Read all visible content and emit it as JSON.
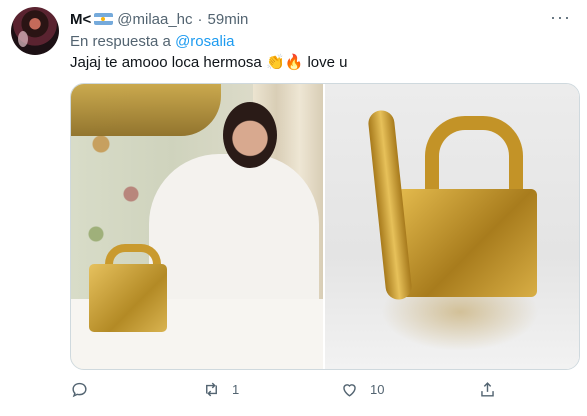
{
  "tweet": {
    "display_name": "M<",
    "handle": "@milaa_hc",
    "separator": "·",
    "time": "59min",
    "reply_prefix": "En respuesta a",
    "reply_mention": "@rosalia",
    "text_before_emoji": "Jajaj te amooo loca hermosa ",
    "emoji": "👏🔥",
    "text_after_emoji": " love u",
    "more_label": "···"
  },
  "actions": {
    "reply_icon": "reply-icon",
    "retweet_icon": "retweet-icon",
    "retweet_count": "1",
    "like_icon": "heart-icon",
    "like_count": "10",
    "share_icon": "share-icon"
  },
  "colors": {
    "link": "#1d9bf0",
    "muted": "#536471",
    "text": "#0f1419",
    "border": "#cfd9de"
  }
}
